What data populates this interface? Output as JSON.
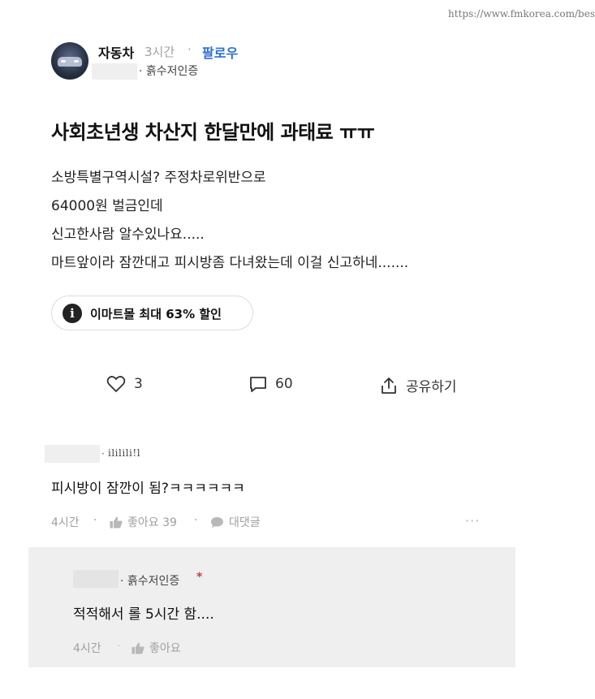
{
  "watermark": "https://www.fmkorea.com/bes",
  "post": {
    "author": "자동차",
    "time": "3시간",
    "separator": "·",
    "follow_label": "팔로우",
    "verification": "· 흙수저인증",
    "title": "사회초년생 차산지 한달만에 과태료 ㅠㅠ",
    "body_lines": [
      "소방특별구역시설? 주정차로위반으로",
      "64000원 벌금인데",
      "신고한사람 알수있나요.....",
      "마트앞이라 잠깐대고 피시방좀 다녀왔는데 이걸 신고하네......."
    ],
    "ad": {
      "icon": "i",
      "label": "이마트몰 최대 63% 할인"
    },
    "actions": {
      "like_count": "3",
      "comment_count": "60",
      "share_label": "공유하기"
    }
  },
  "comment": {
    "verification": "ililili!l",
    "text": "피시방이 잠깐이 됨?ㅋㅋㅋㅋㅋㅋ",
    "time": "4시간",
    "like_label": "좋아요 39",
    "reply_label": "대댓글",
    "more": "···",
    "separator": "·"
  },
  "reply": {
    "verification": "· 흙수저인증",
    "star": "*",
    "text": "적적해서 롤 5시간 함....",
    "time": "4시간",
    "like_label": "좋아요",
    "separator": "·"
  },
  "colors": {
    "follow": "#2c6fd6",
    "meta_gray": "#a0a0a0",
    "reply_bg": "#efefef",
    "star_red": "#d73a3a"
  }
}
